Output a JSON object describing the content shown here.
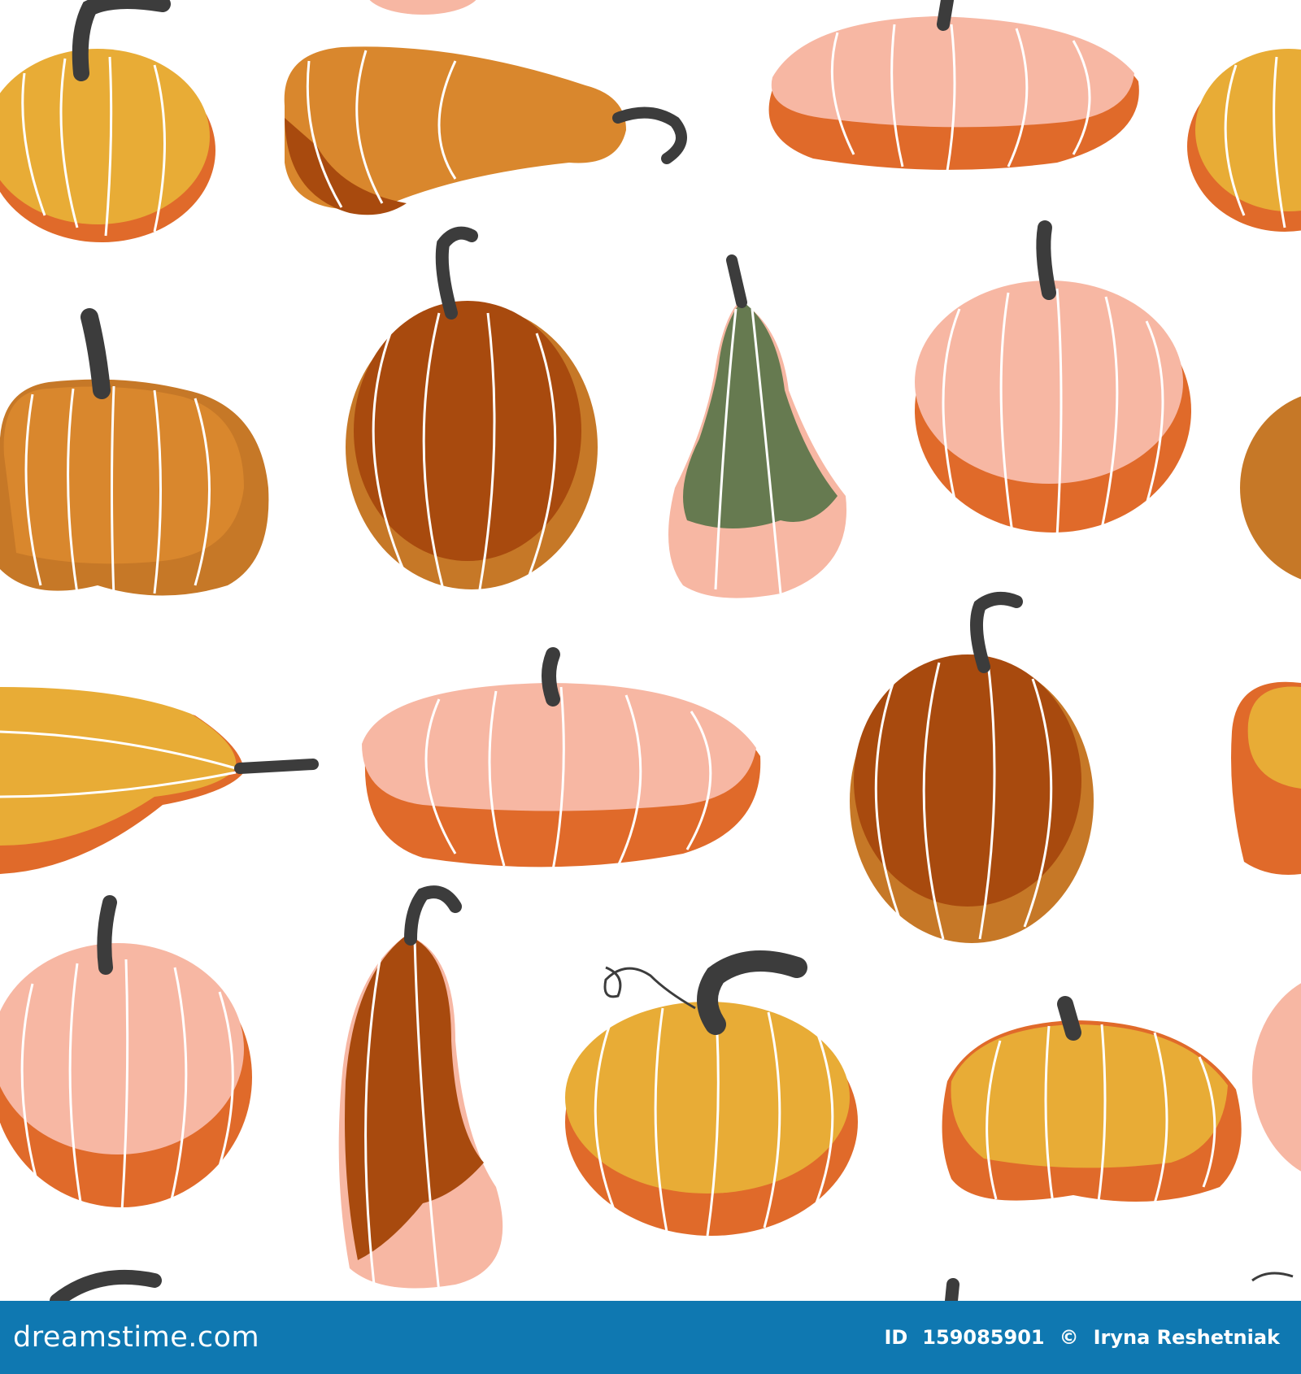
{
  "colors": {
    "background": "#ffffff",
    "footer_bar": "#0f78b1",
    "footer_text": "#ffffff",
    "yellow": "#e8ac36",
    "ochre": "#d9872d",
    "rust_brown": "#a84a0e",
    "bronze": "#c67827",
    "orange": "#e0672a",
    "pink": "#f7b7a3",
    "green": "#667a50",
    "stem": "#3c3c3c",
    "rib_line": "#ffffff"
  },
  "illustration": {
    "subject": "seamless-pattern-of-pumpkins-and-gourds",
    "watermark": "dreamstime"
  },
  "footer": {
    "brand": "dreamstime.com",
    "id_label": "ID",
    "id_value": "159085901",
    "separator": "©",
    "author": "Iryna Reshetniak"
  }
}
